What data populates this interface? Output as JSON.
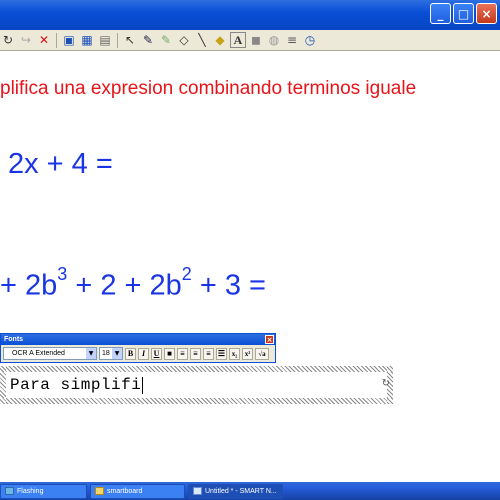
{
  "window": {
    "controls": {
      "minimize": "_",
      "maximize": "□",
      "close": "×"
    }
  },
  "toolbar": {
    "icons": [
      {
        "name": "redo-icon",
        "glyph": "↻"
      },
      {
        "name": "redo-gray-icon",
        "glyph": "↪"
      },
      {
        "name": "delete-icon",
        "glyph": "✕"
      },
      {
        "name": "save-icon",
        "glyph": "▣"
      },
      {
        "name": "screen-capture-icon",
        "glyph": "▦"
      },
      {
        "name": "image-icon",
        "glyph": "▤"
      },
      {
        "name": "select-arrow-icon",
        "glyph": "↖"
      },
      {
        "name": "pen-icon",
        "glyph": "✎"
      },
      {
        "name": "highlighter-icon",
        "glyph": "✎"
      },
      {
        "name": "eraser-icon",
        "glyph": "◇"
      },
      {
        "name": "line-icon",
        "glyph": "╲"
      },
      {
        "name": "fill-icon",
        "glyph": "◆"
      },
      {
        "name": "text-icon",
        "glyph": "A"
      },
      {
        "name": "properties-icon",
        "glyph": "◼"
      },
      {
        "name": "camera-icon",
        "glyph": "◍"
      },
      {
        "name": "more-icon",
        "glyph": "≡"
      },
      {
        "name": "clock-icon",
        "glyph": "◷"
      }
    ]
  },
  "canvas": {
    "heading": "plifica una expresion combinando terminos iguale",
    "eq1": "2x + 4 =",
    "eq2": {
      "part1": "+ 2b",
      "exp1": "3",
      "part2": " + 2 + 2b",
      "exp2": "2",
      "part3": " + 3 ="
    }
  },
  "fonts_panel": {
    "title": "Fonts",
    "close": "×",
    "font_name": "OCR A Extended",
    "font_size": "18",
    "bold": "B",
    "italic": "I",
    "underline": "U",
    "color": "■",
    "align_left": "≡",
    "align_center": "≡",
    "align_right": "≡",
    "bullets": "☰",
    "subscript": "x₂",
    "superscript": "x²",
    "equation": "√a"
  },
  "textbox": {
    "value": "Para simplifi"
  },
  "taskbar": {
    "items": [
      {
        "label": "Flashing"
      },
      {
        "label": "smartboard"
      },
      {
        "label": "Untitled * - SMART N..."
      }
    ]
  },
  "colors": {
    "heading": "#e8141a",
    "equation": "#1a35e6"
  }
}
